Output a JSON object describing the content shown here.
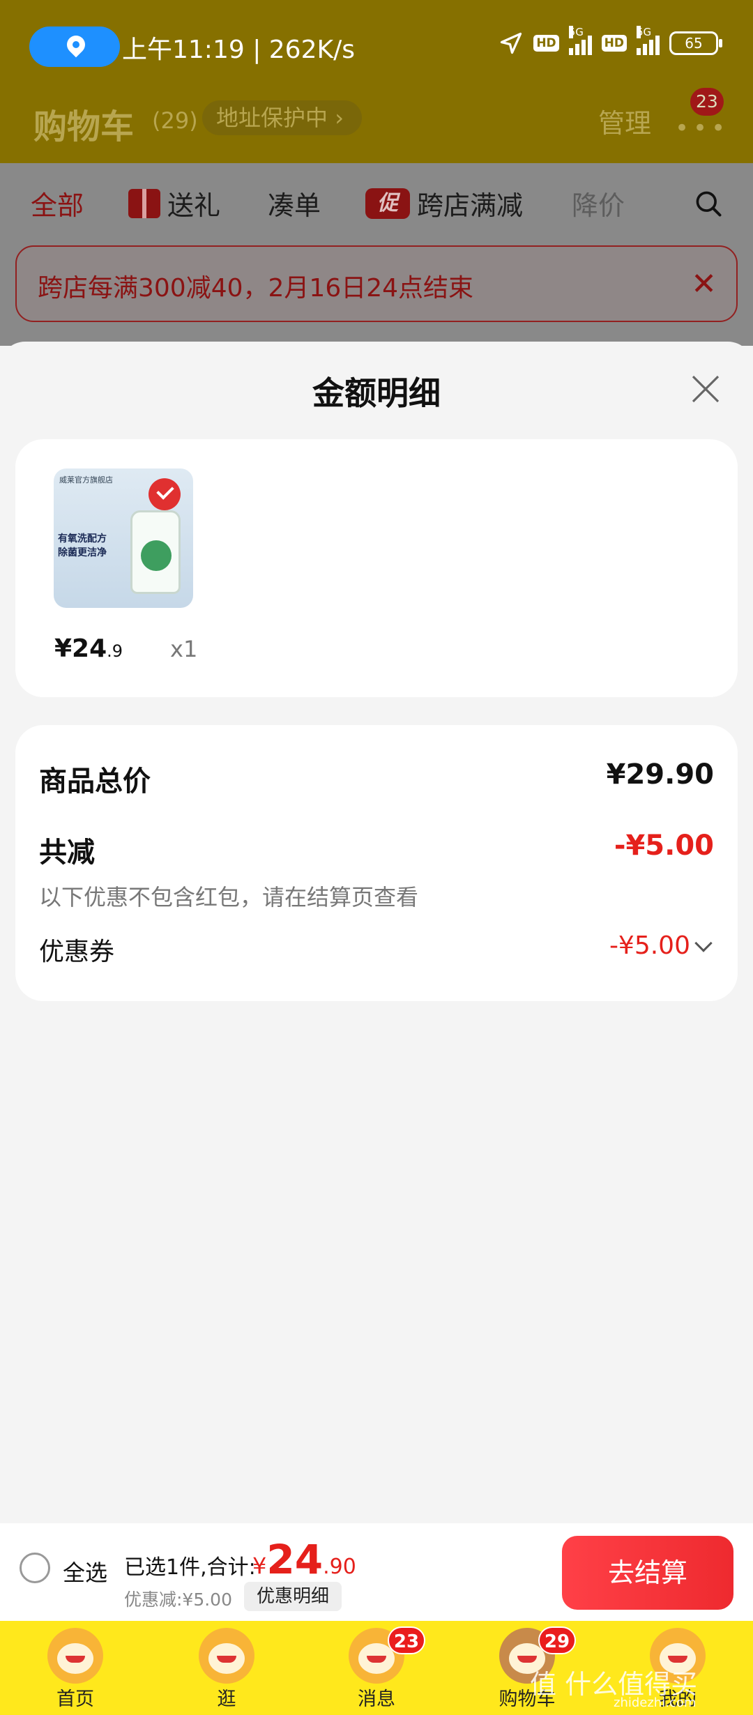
{
  "status_bar": {
    "time": "上午11:19 | 262K/s",
    "hd1": "HD",
    "net1": "5G",
    "hd2": "HD",
    "net2": "5G",
    "battery": "65",
    "icons": [
      "location-pin-icon",
      "navigation-arrow-icon",
      "signal-icon",
      "battery-icon"
    ]
  },
  "header": {
    "title": "购物车",
    "count": "(29)",
    "address_protect": "地址保护中",
    "manage": "管理",
    "more_badge": "23"
  },
  "tabs": [
    {
      "label": "全部",
      "active": true
    },
    {
      "label": "送礼"
    },
    {
      "label": "凑单"
    },
    {
      "label": "跨店满减",
      "tag": "促"
    },
    {
      "label": "降价"
    }
  ],
  "promo_banner": {
    "text": "跨店每满300减40，2月16日24点结束"
  },
  "sheet": {
    "title": "金额明细",
    "product": {
      "store": "威莱官方旗舰店",
      "image_line1": "有氧洗配方",
      "image_line2": "除菌更洁净",
      "price_int": "¥24",
      "price_dec": ".9",
      "qty": "x1"
    },
    "summary": {
      "total_label": "商品总价",
      "total_value": "¥29.90",
      "discount_label": "共减",
      "discount_value": "-¥5.00",
      "note": "以下优惠不包含红包，请在结算页查看",
      "coupon_label": "优惠券",
      "coupon_value": "-¥5.00"
    }
  },
  "checkout": {
    "select_all": "全选",
    "selected_text": "已选1件,合计:",
    "price_symbol": "¥",
    "price_int": "24",
    "price_dec": ".90",
    "discount_text": "优惠减:¥5.00",
    "detail_button": "优惠明细",
    "checkout_button": "去结算"
  },
  "bottom_nav": [
    {
      "label": "首页"
    },
    {
      "label": "逛"
    },
    {
      "label": "消息",
      "badge": "23"
    },
    {
      "label": "购物车",
      "badge": "29"
    },
    {
      "label": "我的"
    }
  ],
  "watermark": {
    "text": "值 什么值得买",
    "sub": "zhidezhi.com"
  },
  "colors": {
    "accent_red": "#e5201b",
    "nav_yellow": "#ffe81c",
    "header_dimmed": "#867000"
  }
}
